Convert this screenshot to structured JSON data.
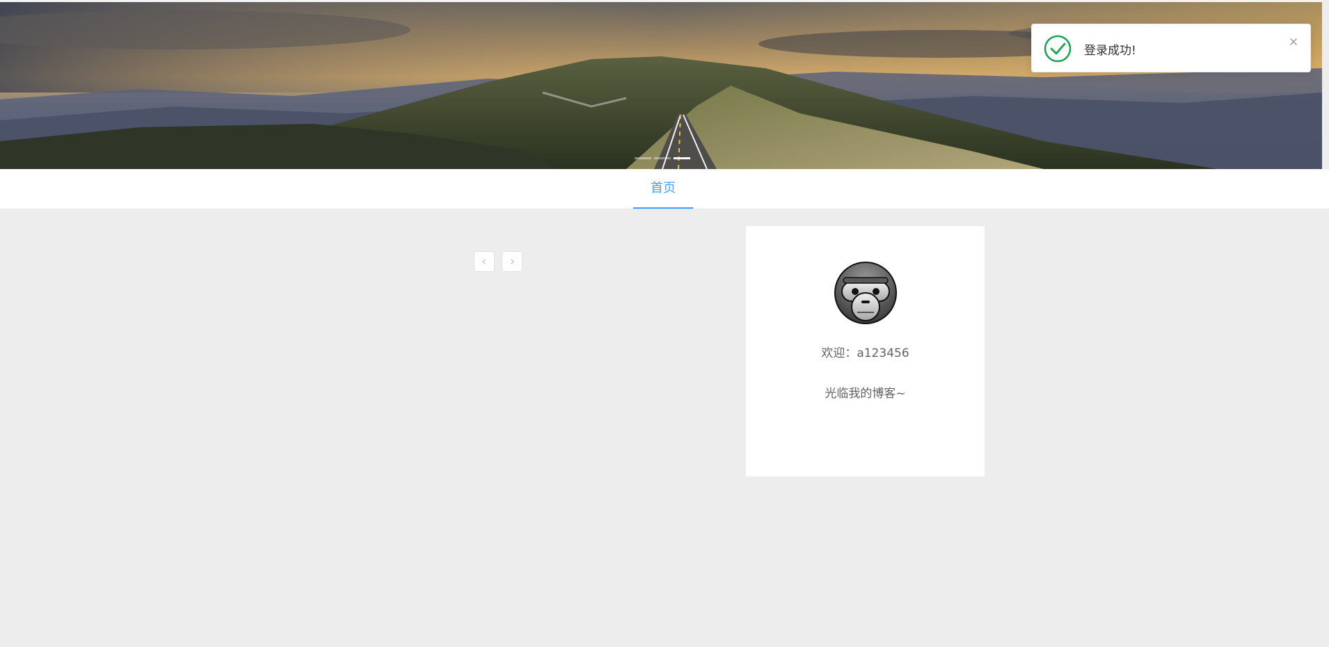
{
  "banner": {
    "description_icon": "landscape-road-banner",
    "indicator_count": 3,
    "active_indicator": 3
  },
  "nav": {
    "tabs": [
      {
        "label": "首页",
        "active": true
      }
    ],
    "accent_color": "#409eff"
  },
  "pager": {
    "prev_icon": "chevron-left-icon",
    "next_icon": "chevron-right-icon"
  },
  "profile": {
    "avatar_icon": "monkey-avatar",
    "welcome_line1": "欢迎：a123456",
    "welcome_line2": "光临我的博客~"
  },
  "toast": {
    "message": "登录成功!",
    "status_icon": "success-check-icon",
    "status_color": "#13a54a",
    "close_icon": "close-icon"
  }
}
